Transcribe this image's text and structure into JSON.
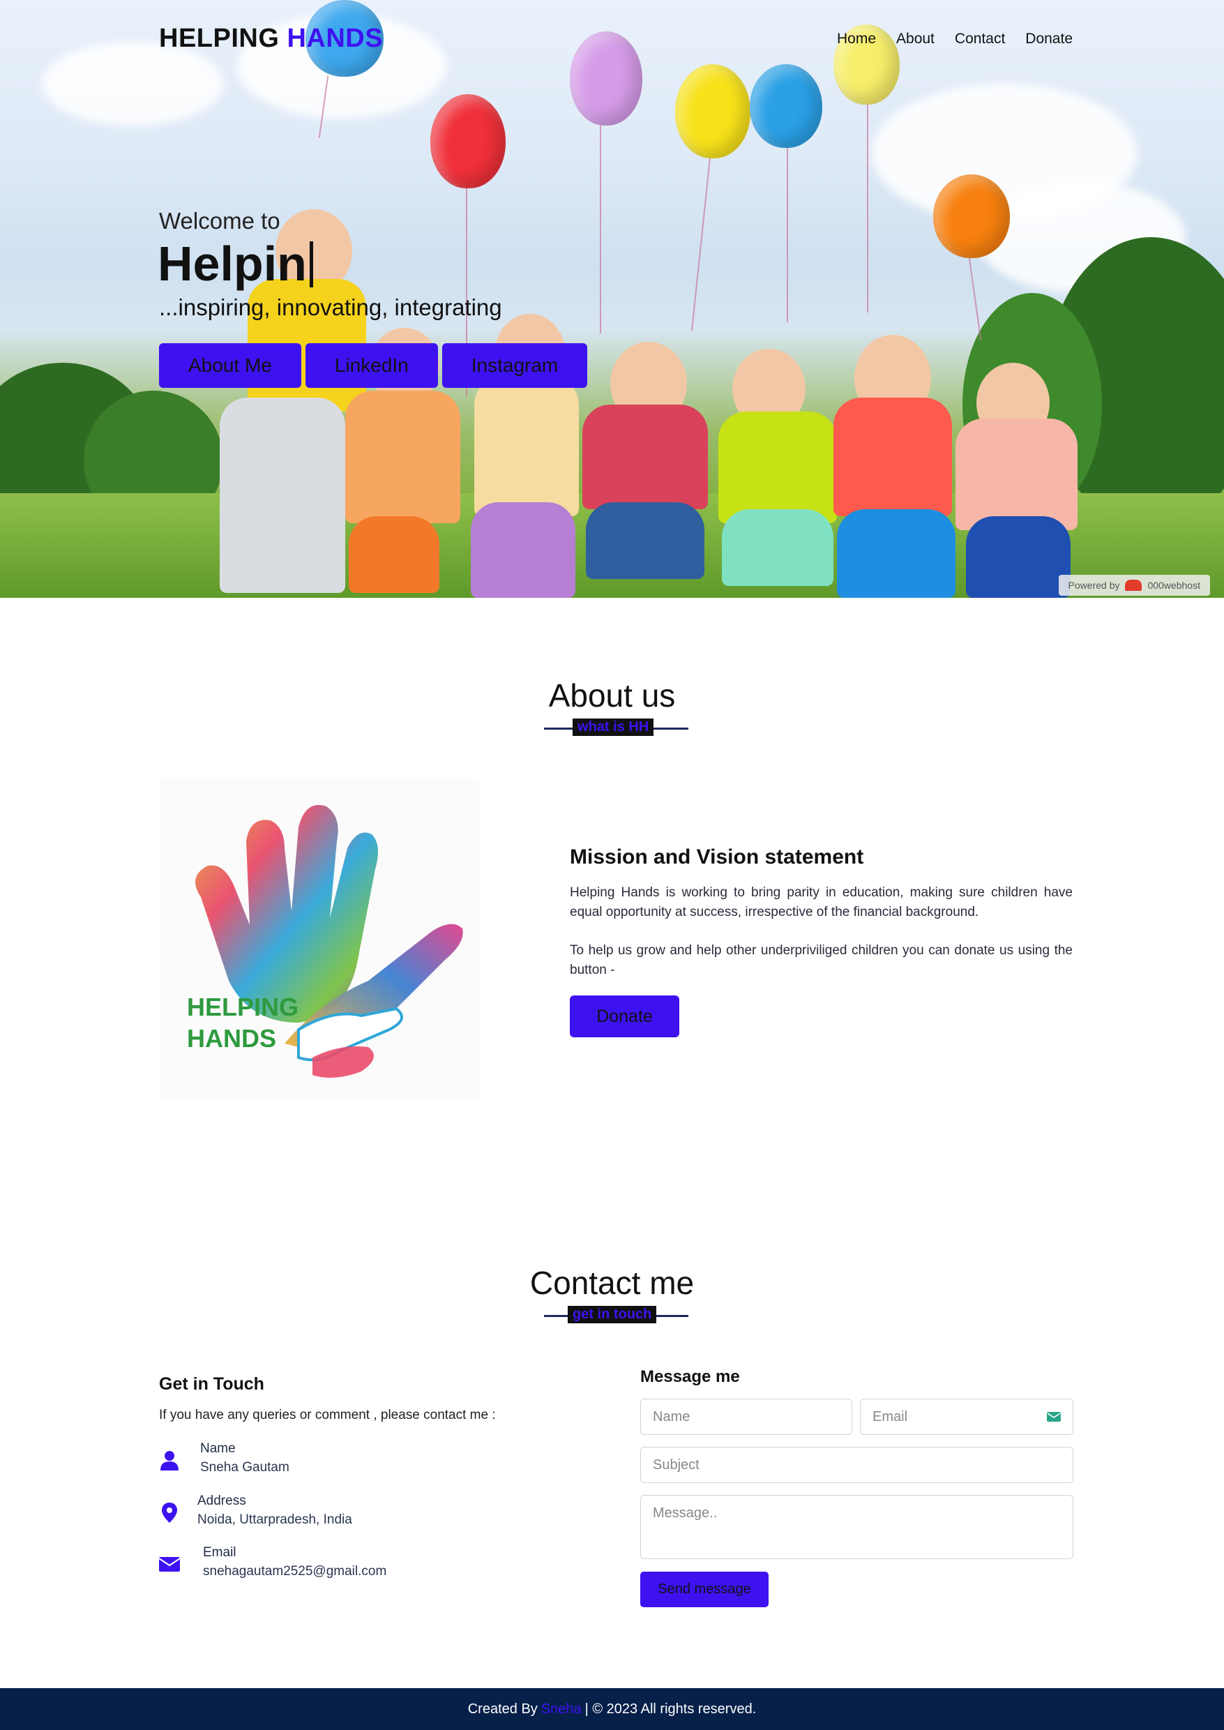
{
  "brand": {
    "part1": "HELPING",
    "part2": "HANDS"
  },
  "nav": {
    "items": [
      "Home",
      "About",
      "Contact",
      "Donate"
    ]
  },
  "hero": {
    "welcome": "Welcome to",
    "typed": "Helpin",
    "tagline": "...inspiring, innovating, integrating",
    "buttons": [
      "About Me",
      "LinkedIn",
      "Instagram"
    ],
    "powered_by": "Powered by",
    "powered_brand": "000webhost"
  },
  "about": {
    "title": "About us",
    "subtitle": "what is HH",
    "logo_text_line1": "HELPING",
    "logo_text_line2": "HANDS",
    "mission_heading": "Mission and Vision statement",
    "paragraph1": "Helping Hands is working to bring parity in education, making sure children have equal opportunity at success, irrespective of the financial background.",
    "paragraph2": "To help us grow and help other underpriviliged children you can donate us using the button -",
    "donate_label": "Donate"
  },
  "contact": {
    "title": "Contact me",
    "subtitle": "get in touch",
    "get_in_touch": "Get in Touch",
    "intro": "If you have any queries or comment , please contact me :",
    "name_label": "Name",
    "name_value": "Sneha Gautam",
    "address_label": "Address",
    "address_value": "Noida, Uttarpradesh, India",
    "email_label": "Email",
    "email_value": "snehagautam2525@gmail.com",
    "form_heading": "Message me",
    "name_placeholder": "Name",
    "email_placeholder": "Email",
    "subject_placeholder": "Subject",
    "message_placeholder": "Message..",
    "send_label": "Send message"
  },
  "footer": {
    "prefix": "Created By",
    "author": "Sneha",
    "suffix": "| © 2023 All rights reserved."
  },
  "colors": {
    "accent": "#3e12f0",
    "footer_bg": "#07204a",
    "heading_line": "#1b2b5a"
  },
  "icons": [
    "user-icon",
    "map-pin-icon",
    "envelope-icon",
    "email-autofill-icon"
  ]
}
